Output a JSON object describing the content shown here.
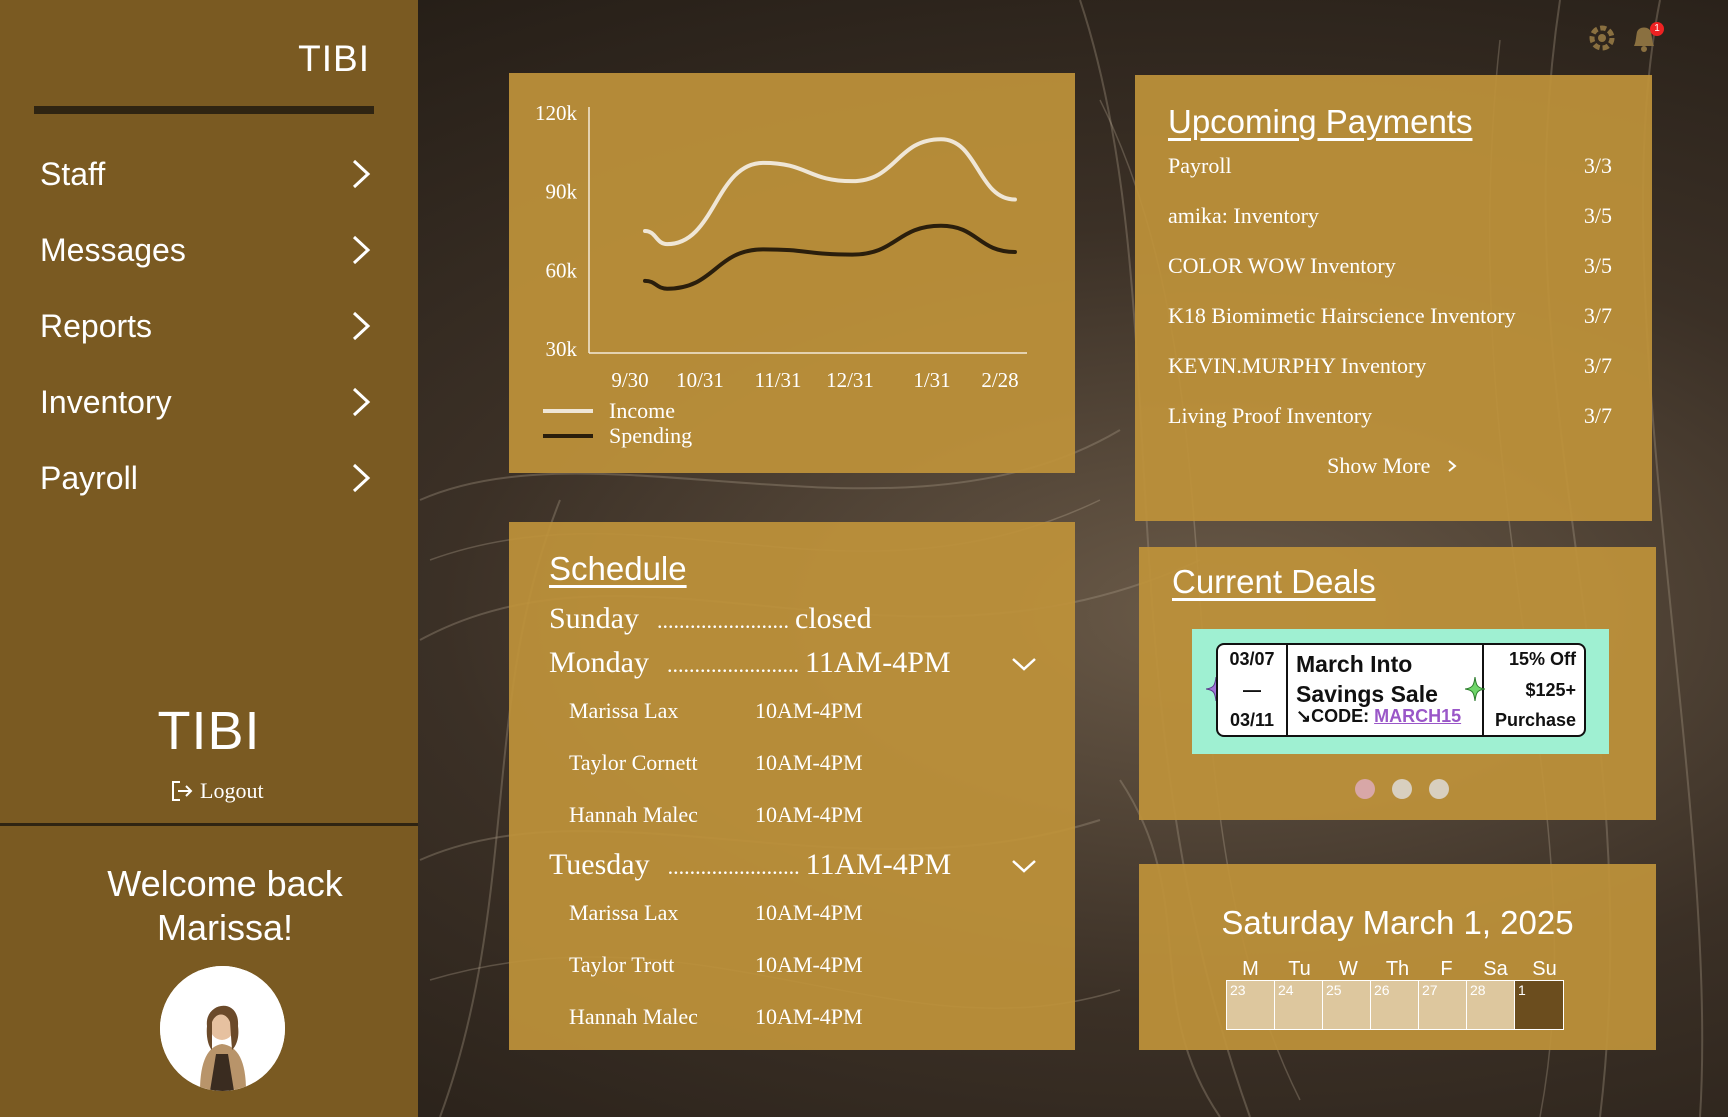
{
  "sidebar": {
    "brand": "TIBI",
    "nav": [
      "Staff",
      "Messages",
      "Reports",
      "Inventory",
      "Payroll"
    ],
    "brand_large": "TIBI",
    "logout_label": "Logout",
    "welcome_line1": "Welcome back",
    "welcome_line2": "Marissa!"
  },
  "header": {
    "notification_count": "1"
  },
  "chart_data": {
    "type": "line",
    "x": [
      "9/30",
      "10/31",
      "11/31",
      "12/31",
      "1/31",
      "2/28"
    ],
    "ytick_labels": [
      "120k",
      "90k",
      "60k",
      "30k"
    ],
    "ylim": [
      30000,
      120000
    ],
    "series": [
      {
        "name": "Income",
        "color": "#efe6d6",
        "points": [
          [
            0.0,
            75000
          ],
          [
            0.3,
            70000
          ],
          [
            1.6,
            101000
          ],
          [
            2.8,
            94000
          ],
          [
            4.0,
            110000
          ],
          [
            5.0,
            87000
          ]
        ]
      },
      {
        "name": "Spending",
        "color": "#2a1e0c",
        "points": [
          [
            0.0,
            56000
          ],
          [
            0.3,
            53000
          ],
          [
            1.6,
            68000
          ],
          [
            2.8,
            66000
          ],
          [
            4.0,
            77000
          ],
          [
            5.0,
            67000
          ]
        ]
      }
    ],
    "legend": "bottom-left"
  },
  "payments": {
    "title": "Upcoming Payments",
    "rows": [
      {
        "name": "Payroll",
        "date": "3/3"
      },
      {
        "name": "amika: Inventory",
        "date": "3/5"
      },
      {
        "name": "COLOR WOW Inventory",
        "date": "3/5"
      },
      {
        "name": "K18 Biomimetic Hairscience Inventory",
        "date": "3/7"
      },
      {
        "name": "KEVIN.MURPHY Inventory",
        "date": "3/7"
      },
      {
        "name": "Living Proof Inventory",
        "date": "3/7"
      }
    ],
    "show_more": "Show More"
  },
  "schedule": {
    "title": "Schedule",
    "dots": "........................",
    "days": [
      {
        "day": "Sunday",
        "hours": "closed"
      },
      {
        "day": "Monday",
        "hours": "11AM-4PM"
      },
      {
        "day": "Tuesday",
        "hours": "11AM-4PM"
      }
    ],
    "monday_staff": [
      {
        "name": "Marissa Lax",
        "hours": "10AM-4PM"
      },
      {
        "name": "Taylor Cornett",
        "hours": "10AM-4PM"
      },
      {
        "name": "Hannah Malec",
        "hours": "10AM-4PM"
      }
    ],
    "tuesday_staff": [
      {
        "name": "Marissa Lax",
        "hours": "10AM-4PM"
      },
      {
        "name": "Taylor Trott",
        "hours": "10AM-4PM"
      },
      {
        "name": "Hannah Malec",
        "hours": "10AM-4PM"
      }
    ]
  },
  "deals": {
    "title": "Current Deals",
    "coupon": {
      "start": "03/07",
      "dash": "—",
      "end": "03/11",
      "line1": "March Into",
      "line2": "Savings Sale",
      "code_prefix": "↘CODE: ",
      "code": "MARCH15",
      "off": "15% Off",
      "min": "$125+",
      "purchase": "Purchase"
    },
    "active_page": 1,
    "pages": 3
  },
  "calendar": {
    "date": "Saturday March 1, 2025",
    "weekdays": [
      "M",
      "Tu",
      "W",
      "Th",
      "F",
      "Sa",
      "Su"
    ],
    "days": [
      "23",
      "24",
      "25",
      "26",
      "27",
      "28",
      "1"
    ],
    "today": "1"
  },
  "colors": {
    "sidebar": "#7a5a22",
    "card": "#be923a",
    "coupon_bg": "#9ff0d2",
    "code": "#9a57c8"
  }
}
